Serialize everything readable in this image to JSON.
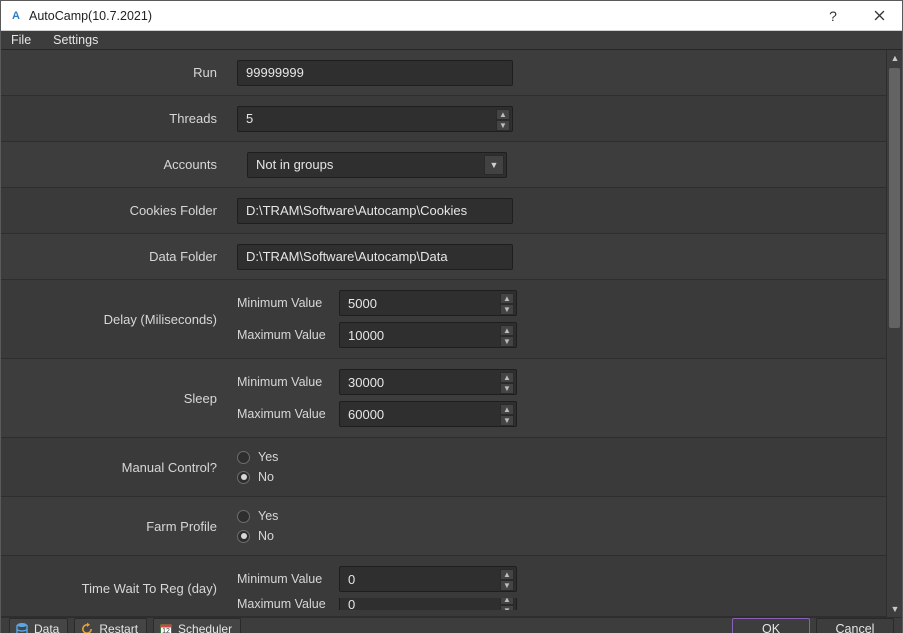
{
  "window": {
    "title": "AutoCamp(10.7.2021)"
  },
  "menubar": {
    "file": "File",
    "settings": "Settings"
  },
  "form": {
    "run": {
      "label": "Run",
      "value": "99999999"
    },
    "threads": {
      "label": "Threads",
      "value": "5"
    },
    "accounts": {
      "label": "Accounts",
      "value": "Not in groups"
    },
    "cookies_folder": {
      "label": "Cookies Folder",
      "value": "D:\\TRAM\\Software\\Autocamp\\Cookies"
    },
    "data_folder": {
      "label": "Data Folder",
      "value": "D:\\TRAM\\Software\\Autocamp\\Data"
    },
    "delay": {
      "label": "Delay (Miliseconds)",
      "min_label": "Minimum Value",
      "min_value": "5000",
      "max_label": "Maximum Value",
      "max_value": "10000"
    },
    "sleep": {
      "label": "Sleep",
      "min_label": "Minimum Value",
      "min_value": "30000",
      "max_label": "Maximum Value",
      "max_value": "60000"
    },
    "manual_control": {
      "label": "Manual Control?",
      "yes": "Yes",
      "no": "No",
      "selected": "no"
    },
    "farm_profile": {
      "label": "Farm Profile",
      "yes": "Yes",
      "no": "No",
      "selected": "no"
    },
    "time_wait": {
      "label": "Time Wait To Reg (day)",
      "min_label": "Minimum Value",
      "min_value": "0",
      "max_label": "Maximum Value",
      "max_value": "0"
    }
  },
  "bottom": {
    "data": "Data",
    "restart": "Restart",
    "scheduler": "Scheduler",
    "ok": "OK",
    "cancel": "Cancel"
  }
}
